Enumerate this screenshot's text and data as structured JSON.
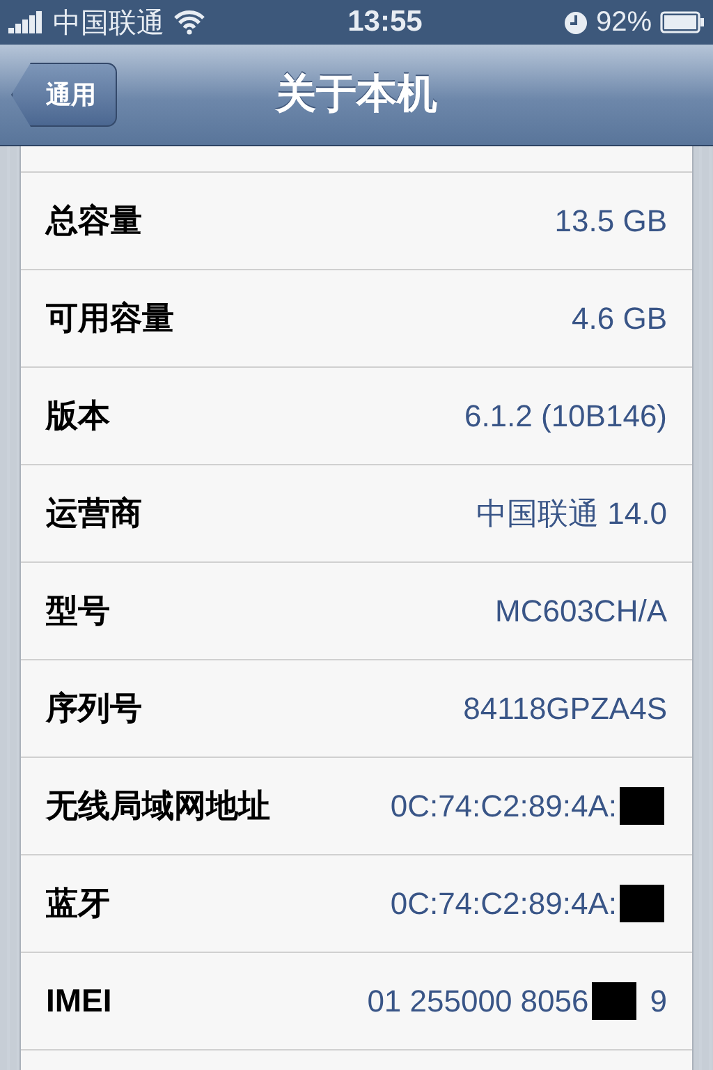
{
  "status_bar": {
    "carrier": "中国联通",
    "time": "13:55",
    "battery": "92%"
  },
  "nav_bar": {
    "back": "通用",
    "title": "关于本机"
  },
  "rows": [
    {
      "label": "总容量",
      "value": "13.5 GB",
      "redacted": false
    },
    {
      "label": "可用容量",
      "value": "4.6 GB",
      "redacted": false
    },
    {
      "label": "版本",
      "value": "6.1.2 (10B146)",
      "redacted": false
    },
    {
      "label": "运营商",
      "value": "中国联通 14.0",
      "redacted": false
    },
    {
      "label": "型号",
      "value": "MC603CH/A",
      "redacted": false
    },
    {
      "label": "序列号",
      "value": "84118GPZA4S",
      "redacted": false
    },
    {
      "label": "无线局域网地址",
      "value": "0C:74:C2:89:4A:",
      "redacted": true
    },
    {
      "label": "蓝牙",
      "value": "0C:74:C2:89:4A:",
      "redacted": true
    },
    {
      "label": "IMEI",
      "value": "01 255000 8056",
      "redacted": true,
      "value_end": "9"
    }
  ]
}
